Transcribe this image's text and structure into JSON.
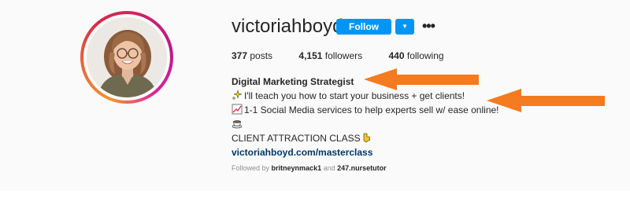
{
  "profile": {
    "username": "victoriahboyd",
    "follow_label": "Follow",
    "dropdown_icon": "chevron-down-icon",
    "more_icon": "more-options-icon",
    "more_glyph": "•••"
  },
  "stats": {
    "posts_count": "377",
    "posts_label": "posts",
    "followers_count": "4,151",
    "followers_label": "followers",
    "following_count": "440",
    "following_label": "following"
  },
  "bio": {
    "name": "Digital Marketing Strategist",
    "line1": "I'll teach you how to start your business + get clients!",
    "line2": "1-1 Social Media services to help experts sell w/ ease online!",
    "line4": "CLIENT ATTRACTION CLASS",
    "link": "victoriahboyd.com/masterclass"
  },
  "followed_by": {
    "prefix": "Followed by",
    "user1": "britneynmack1",
    "and": "and",
    "user2": "247.nursetutor"
  },
  "colors": {
    "follow_blue": "#0095f6",
    "link_blue": "#00376b",
    "arrow_orange": "#f47b20",
    "muted": "#8e8e8e"
  }
}
